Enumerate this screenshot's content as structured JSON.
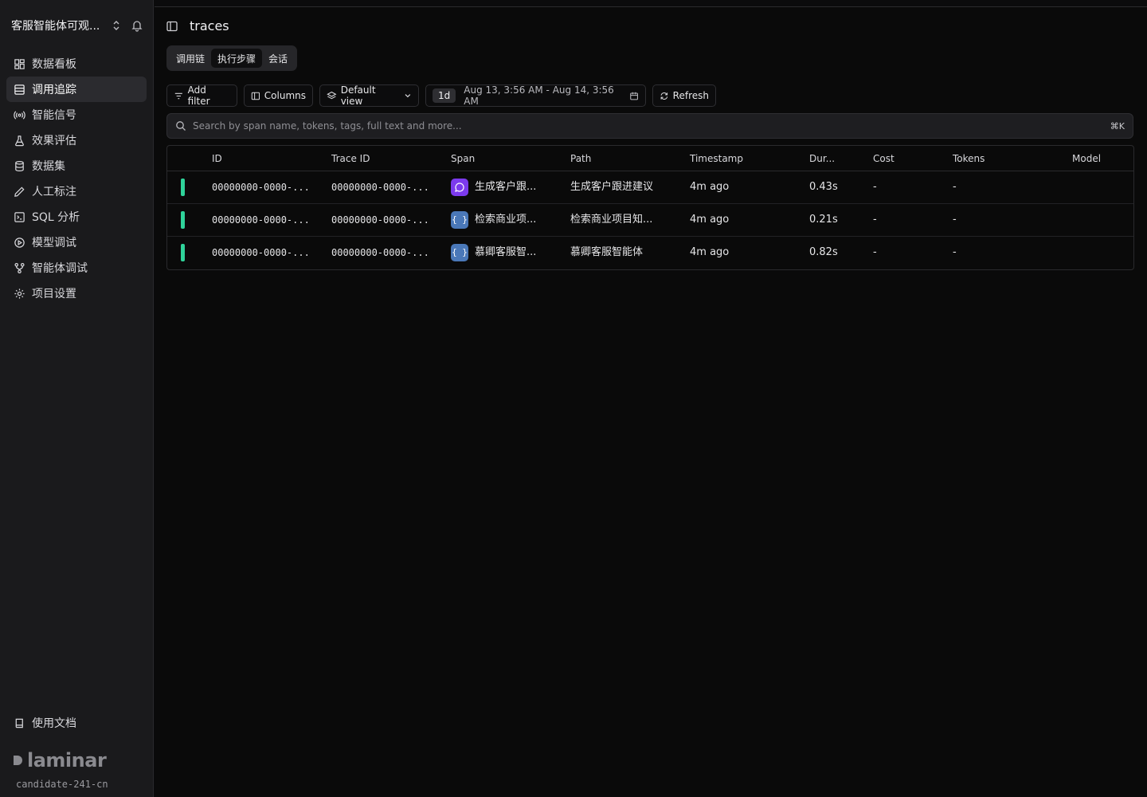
{
  "project": {
    "name": "客服智能体可观..."
  },
  "nav": [
    {
      "label": "数据看板",
      "icon": "dashboard-icon",
      "active": false
    },
    {
      "label": "调用追踪",
      "icon": "traces-icon",
      "active": true
    },
    {
      "label": "智能信号",
      "icon": "signal-icon",
      "active": false
    },
    {
      "label": "效果评估",
      "icon": "flask-icon",
      "active": false
    },
    {
      "label": "数据集",
      "icon": "database-icon",
      "active": false
    },
    {
      "label": "人工标注",
      "icon": "pencil-icon",
      "active": false
    },
    {
      "label": "SQL 分析",
      "icon": "terminal-icon",
      "active": false
    },
    {
      "label": "模型调试",
      "icon": "play-icon",
      "active": false
    },
    {
      "label": "智能体调试",
      "icon": "workflow-icon",
      "active": false
    },
    {
      "label": "项目设置",
      "icon": "gear-icon",
      "active": false
    }
  ],
  "docs": {
    "label": "使用文档"
  },
  "brand": {
    "logo_text": "laminar",
    "environment": "candidate-241-cn"
  },
  "header": {
    "title": "traces"
  },
  "tabs": [
    {
      "label": "调用链",
      "active": false
    },
    {
      "label": "执行步骤",
      "active": true
    },
    {
      "label": "会话",
      "active": false
    }
  ],
  "toolbar": {
    "add_filter": "Add filter",
    "columns": "Columns",
    "view": "Default view",
    "range_badge": "1d",
    "range_text": "Aug 13, 3:56 AM - Aug 14, 3:56 AM",
    "refresh": "Refresh"
  },
  "search": {
    "placeholder": "Search by span name, tokens, tags, full text and more...",
    "shortcut": "⌘K"
  },
  "table": {
    "columns": [
      "ID",
      "Trace ID",
      "Span",
      "Path",
      "Timestamp",
      "Dur...",
      "Cost",
      "Tokens",
      "Model"
    ],
    "rows": [
      {
        "id": "00000000-0000-...",
        "trace_id": "00000000-0000-...",
        "span": "生成客户跟...",
        "span_type": "llm",
        "path": "生成客户跟进建议",
        "timestamp": "4m ago",
        "duration": "0.43s",
        "cost": "-",
        "tokens": "-",
        "model": ""
      },
      {
        "id": "00000000-0000-...",
        "trace_id": "00000000-0000-...",
        "span": "检索商业项...",
        "span_type": "default",
        "path": "检索商业项目知...",
        "timestamp": "4m ago",
        "duration": "0.21s",
        "cost": "-",
        "tokens": "-",
        "model": ""
      },
      {
        "id": "00000000-0000-...",
        "trace_id": "00000000-0000-...",
        "span": "慕卿客服智...",
        "span_type": "default",
        "path": "慕卿客服智能体",
        "timestamp": "4m ago",
        "duration": "0.82s",
        "cost": "-",
        "tokens": "-",
        "model": ""
      }
    ]
  },
  "colors": {
    "status_ok": "#2fd39a",
    "llm_span": "#7c3aed",
    "default_span": "#4a78b8"
  }
}
